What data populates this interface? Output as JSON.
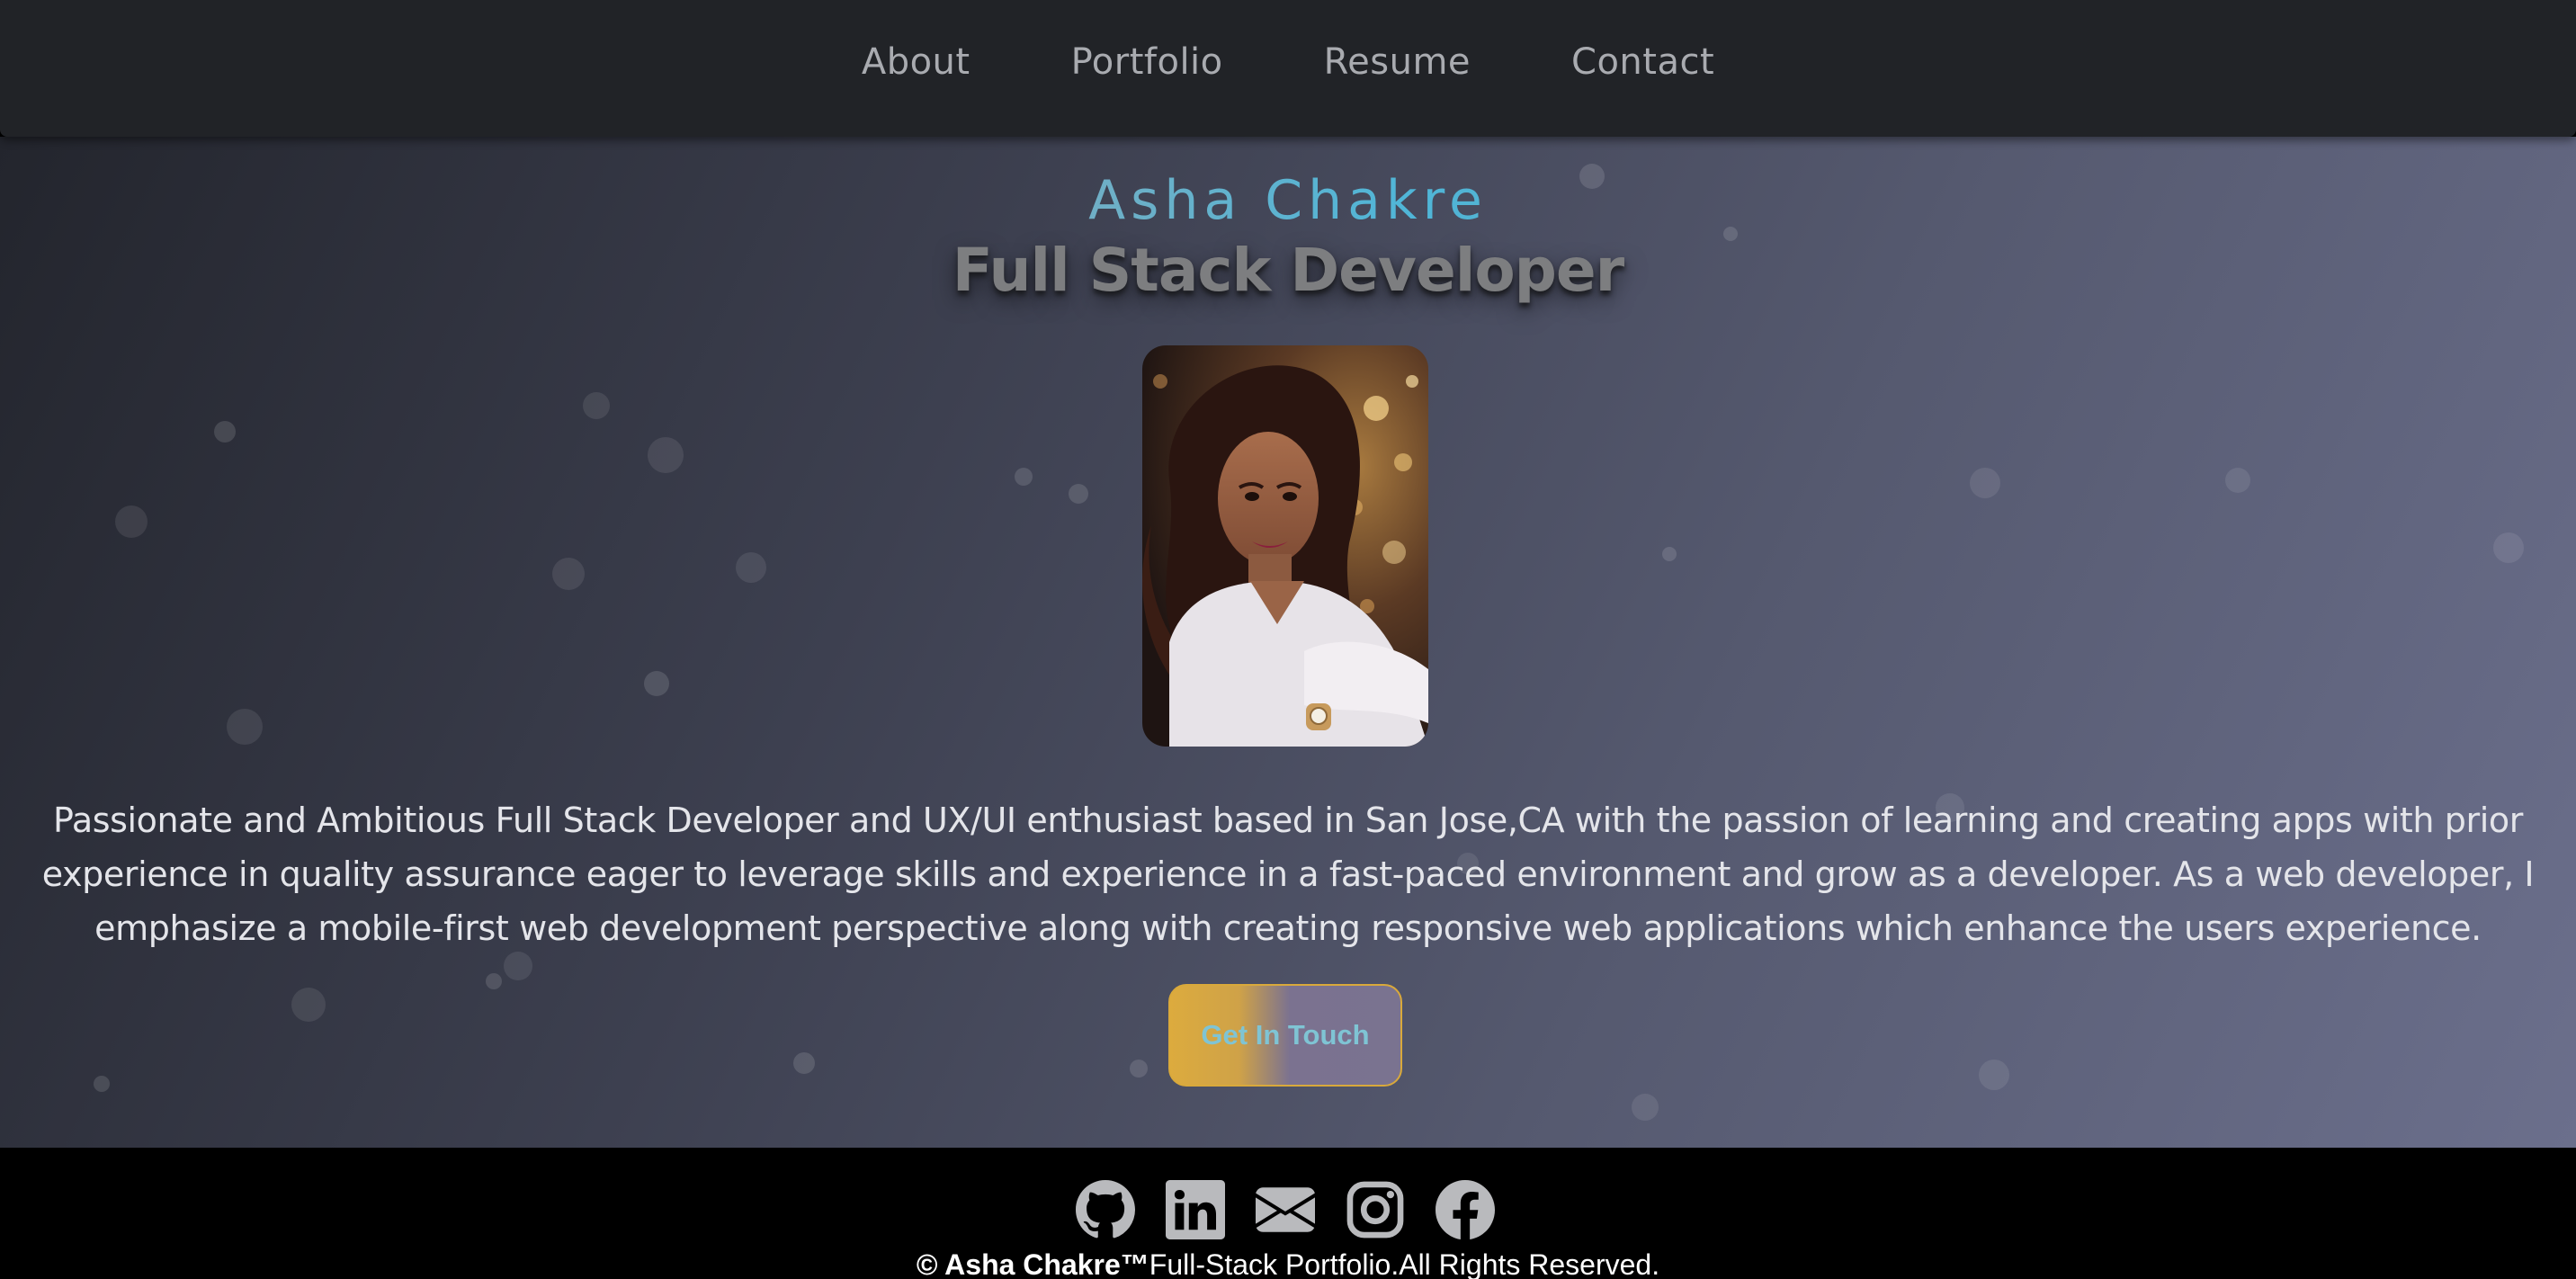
{
  "nav": {
    "items": [
      {
        "label": "About"
      },
      {
        "label": "Portfolio"
      },
      {
        "label": "Resume"
      },
      {
        "label": "Contact"
      }
    ]
  },
  "hero": {
    "name": "Asha Chakre",
    "title": "Full Stack Developer",
    "bio": "Passionate and Ambitious Full Stack Developer and UX/UI enthusiast based in San Jose,CA with the passion of learning and creating apps with prior experience in quality assurance eager to leverage skills and experience in a fast-paced environment and grow as a developer. As a web developer, I emphasize a mobile-first web development perspective along with creating responsive web applications which enhance the users experience.",
    "cta_label": "Get In Touch"
  },
  "footer": {
    "social_icons": [
      "github-icon",
      "linkedin-icon",
      "email-icon",
      "instagram-icon",
      "facebook-icon"
    ],
    "copyright_owner": "© Asha Chakre™",
    "copyright_rest": "Full-Stack Portfolio.All Rights Reserved."
  },
  "colors": {
    "navbar": "#212327",
    "nav_text": "#a9abb0",
    "cta_gold": "#dcab3e",
    "cta_text": "#7fc4d4",
    "footer": "#000000"
  }
}
